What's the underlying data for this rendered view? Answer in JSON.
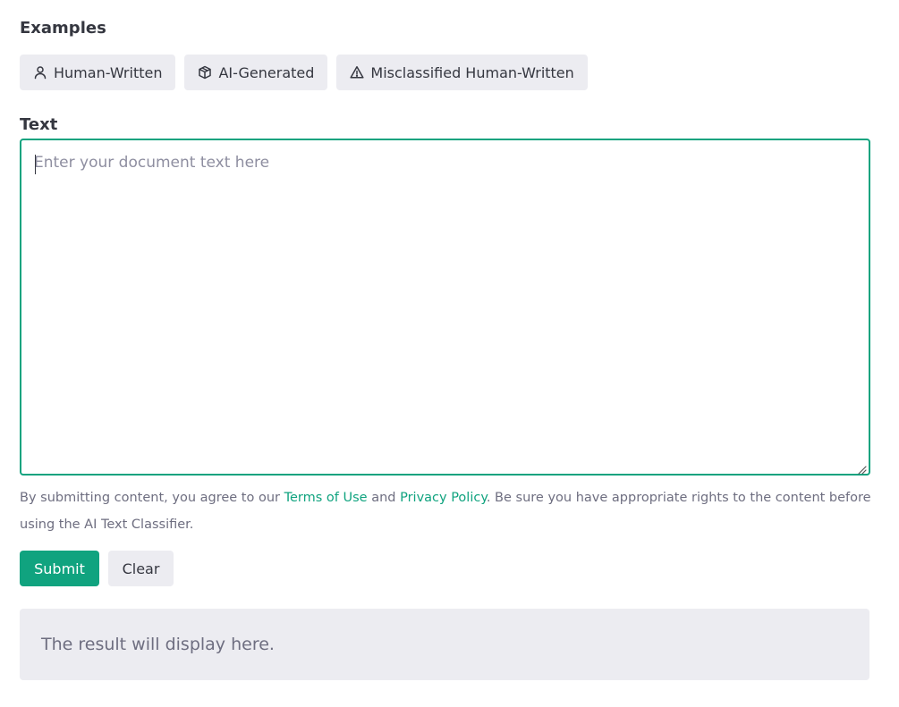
{
  "examples": {
    "label": "Examples",
    "buttons": [
      {
        "icon": "person-icon",
        "label": "Human-Written"
      },
      {
        "icon": "cube-icon",
        "label": "AI-Generated"
      },
      {
        "icon": "warning-icon",
        "label": "Misclassified Human-Written"
      }
    ]
  },
  "text_input": {
    "label": "Text",
    "placeholder": "Enter your document text here",
    "value": ""
  },
  "disclaimer": {
    "prefix": "By submitting content, you agree to our ",
    "terms_link": "Terms of Use",
    "middle": " and ",
    "privacy_link": "Privacy Policy",
    "suffix": ". Be sure you have appropriate rights to the content before using the AI Text Classifier."
  },
  "actions": {
    "submit_label": "Submit",
    "clear_label": "Clear"
  },
  "result": {
    "text": "The result will display here."
  },
  "colors": {
    "accent": "#10a37f",
    "button_bg": "#ececf1",
    "text_primary": "#353740",
    "text_muted": "#6e6e80"
  }
}
